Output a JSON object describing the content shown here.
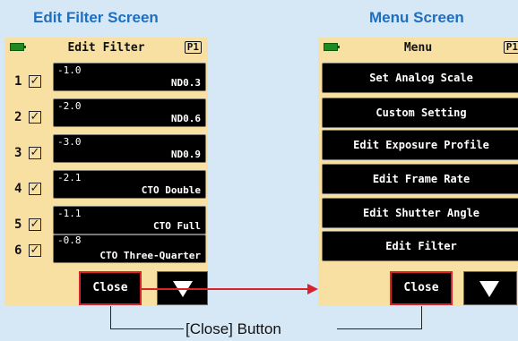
{
  "captions": {
    "left": "Edit Filter Screen",
    "right": "Menu Screen"
  },
  "edit_filter_screen": {
    "title": "Edit Filter",
    "page_badge": "P1",
    "filters": [
      {
        "number": "1",
        "checked": "✓",
        "value": "-1.0",
        "name": "ND0.3"
      },
      {
        "number": "2",
        "checked": "✓",
        "value": "-2.0",
        "name": "ND0.6"
      },
      {
        "number": "3",
        "checked": "✓",
        "value": "-3.0",
        "name": "ND0.9"
      },
      {
        "number": "4",
        "checked": "✓",
        "value": "-2.1",
        "name": "CTO Double"
      },
      {
        "number": "5",
        "checked": "✓",
        "value": "-1.1",
        "name": "CTO Full"
      },
      {
        "number": "6",
        "checked": "✓",
        "value": "-0.8",
        "name": "CTO Three-Quarter"
      }
    ],
    "close_label": "Close"
  },
  "menu_screen": {
    "title": "Menu",
    "page_badge": "P1",
    "items": [
      "Set Analog Scale",
      "Custom Setting",
      "Edit Exposure Profile",
      "Edit Frame Rate",
      "Edit Shutter Angle",
      "Edit Filter"
    ],
    "close_label": "Close"
  },
  "callout_label": "[Close] Button",
  "colors": {
    "background": "#d6e7f6",
    "screen": "#f8e0a3",
    "caption": "#1f6fbf",
    "highlight": "#d8232a",
    "battery": "#1d8b1d"
  },
  "icons": [
    "battery-icon",
    "checkbox-icon",
    "down-arrow-icon",
    "arrow-right-icon"
  ]
}
